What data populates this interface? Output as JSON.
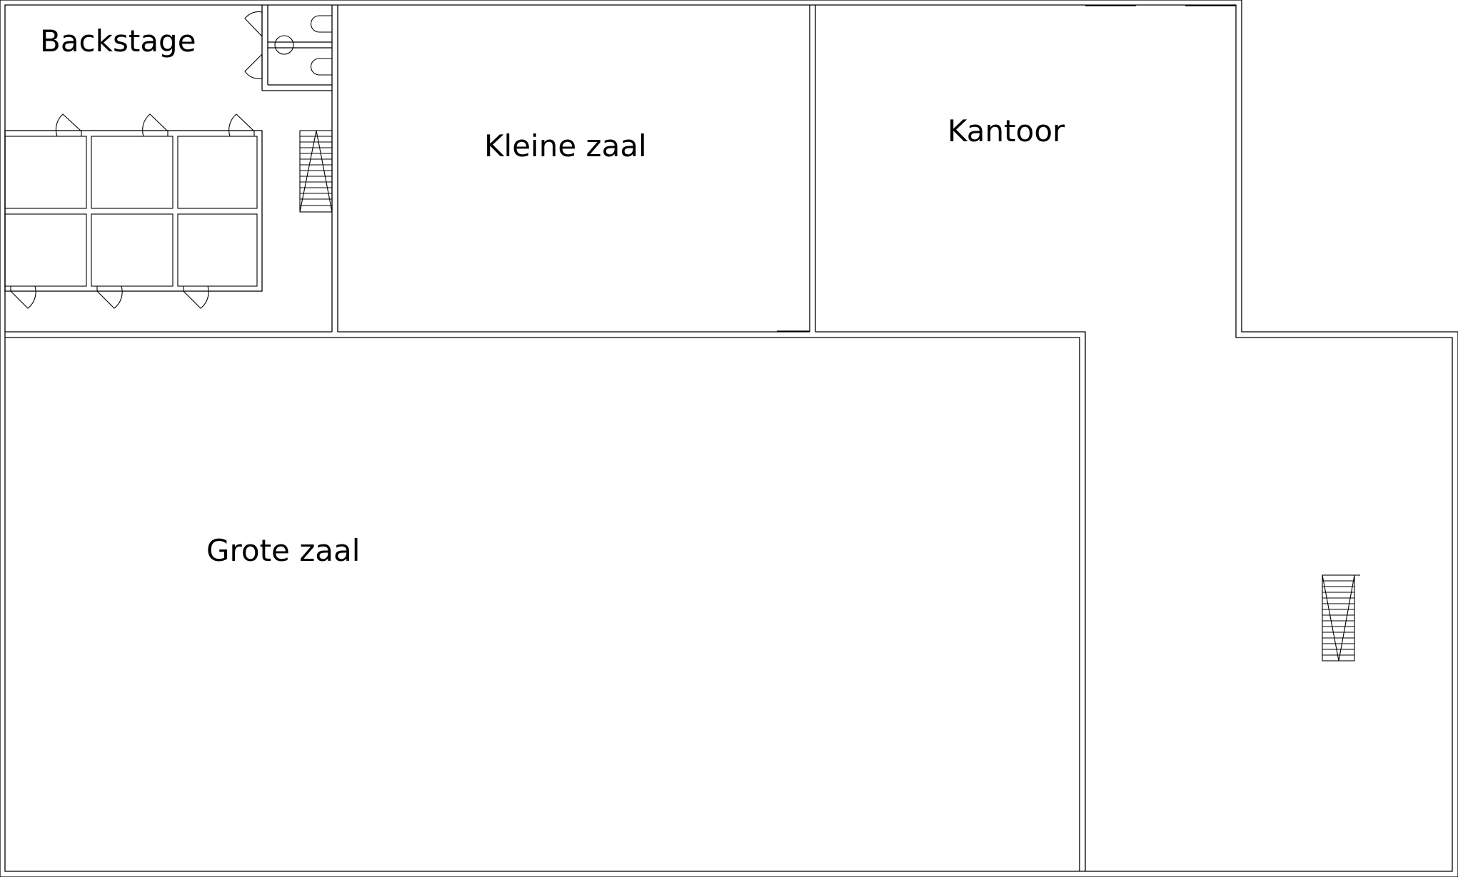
{
  "floor_plan": {
    "rooms": {
      "backstage": "Backstage",
      "kleine_zaal": "Kleine zaal",
      "kantoor": "Kantoor",
      "grote_zaal": "Grote zaal"
    },
    "colors": {
      "wall": "#000000",
      "background": "#ffffff"
    },
    "symbols": [
      "door-swing-icon",
      "staircase-icon",
      "toilet-icon",
      "sink-icon"
    ]
  }
}
